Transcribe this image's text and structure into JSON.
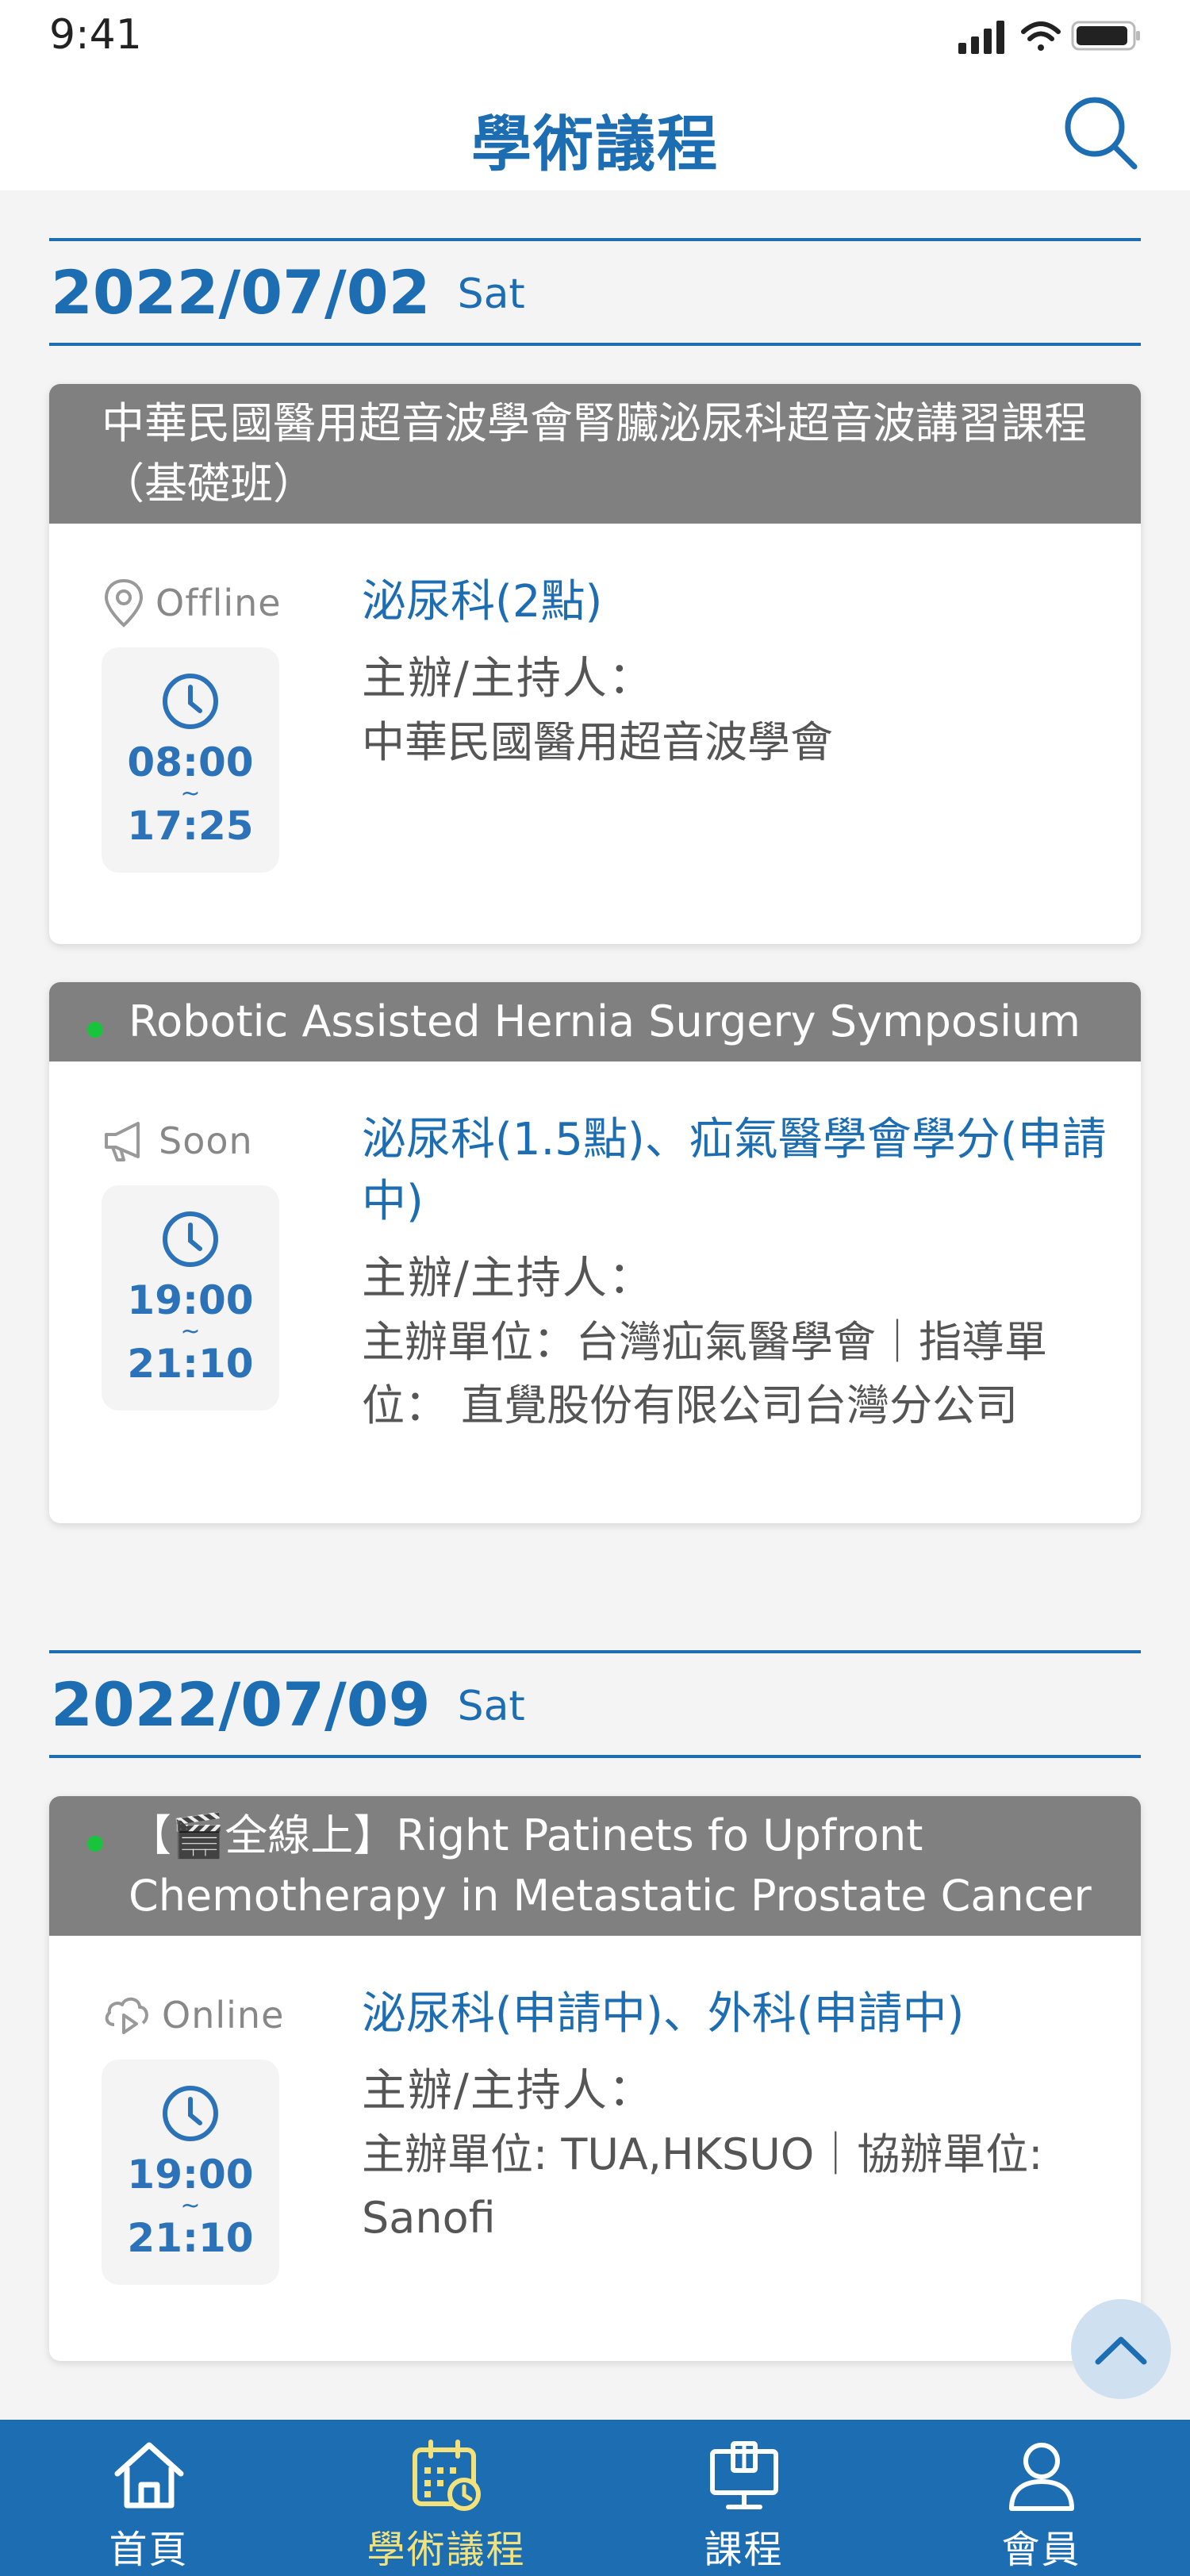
{
  "status_bar": {
    "time": "9:41"
  },
  "header": {
    "title": "學術議程"
  },
  "sections": [
    {
      "date": "2022/07/02",
      "day": "Sat",
      "events": [
        {
          "title": "中華民國醫用超音波學會腎臟泌尿科超音波講習課程（基礎班）",
          "status": "Offline",
          "status_icon": "location-pin-icon",
          "start": "08:00",
          "tilde": "~",
          "end": "17:25",
          "credits": "泌尿科(2點)",
          "organizer_label": "主辦/主持人：",
          "organizer": "中華民國醫用超音波學會"
        },
        {
          "title": "Robotic Assisted Hernia Surgery Symposium",
          "status": "Soon",
          "status_icon": "megaphone-icon",
          "start": "19:00",
          "tilde": "~",
          "end": "21:10",
          "credits": "泌尿科(1.5點)、疝氣醫學會學分(申請中)",
          "organizer_label": "主辦/主持人：",
          "organizer": "主辦單位：台灣疝氣醫學會｜指導單位： 直覺股份有限公司台灣分公司"
        }
      ]
    },
    {
      "date": "2022/07/09",
      "day": "Sat",
      "events": [
        {
          "title": "【🎬全線上】Right Patinets fo Upfront Chemotherapy in Metastatic Prostate Cancer",
          "status": "Online",
          "status_icon": "cloud-play-icon",
          "start": "19:00",
          "tilde": "~",
          "end": "21:10",
          "credits": "泌尿科(申請中)、外科(申請中)",
          "organizer_label": "主辦/主持人：",
          "organizer": "主辦單位: TUA,HKSUO｜協辦單位: Sanofi"
        }
      ]
    }
  ],
  "tabs": [
    {
      "label": "首頁",
      "icon": "home-icon",
      "active": false
    },
    {
      "label": "學術議程",
      "icon": "calendar-icon",
      "active": true
    },
    {
      "label": "課程",
      "icon": "monitor-icon",
      "active": false
    },
    {
      "label": "會員",
      "icon": "user-icon",
      "active": false
    }
  ],
  "colors": {
    "primary": "#1d6db3",
    "header_gray": "#808080",
    "live_dot": "#18c43c",
    "active_tab": "#f3e27a"
  }
}
